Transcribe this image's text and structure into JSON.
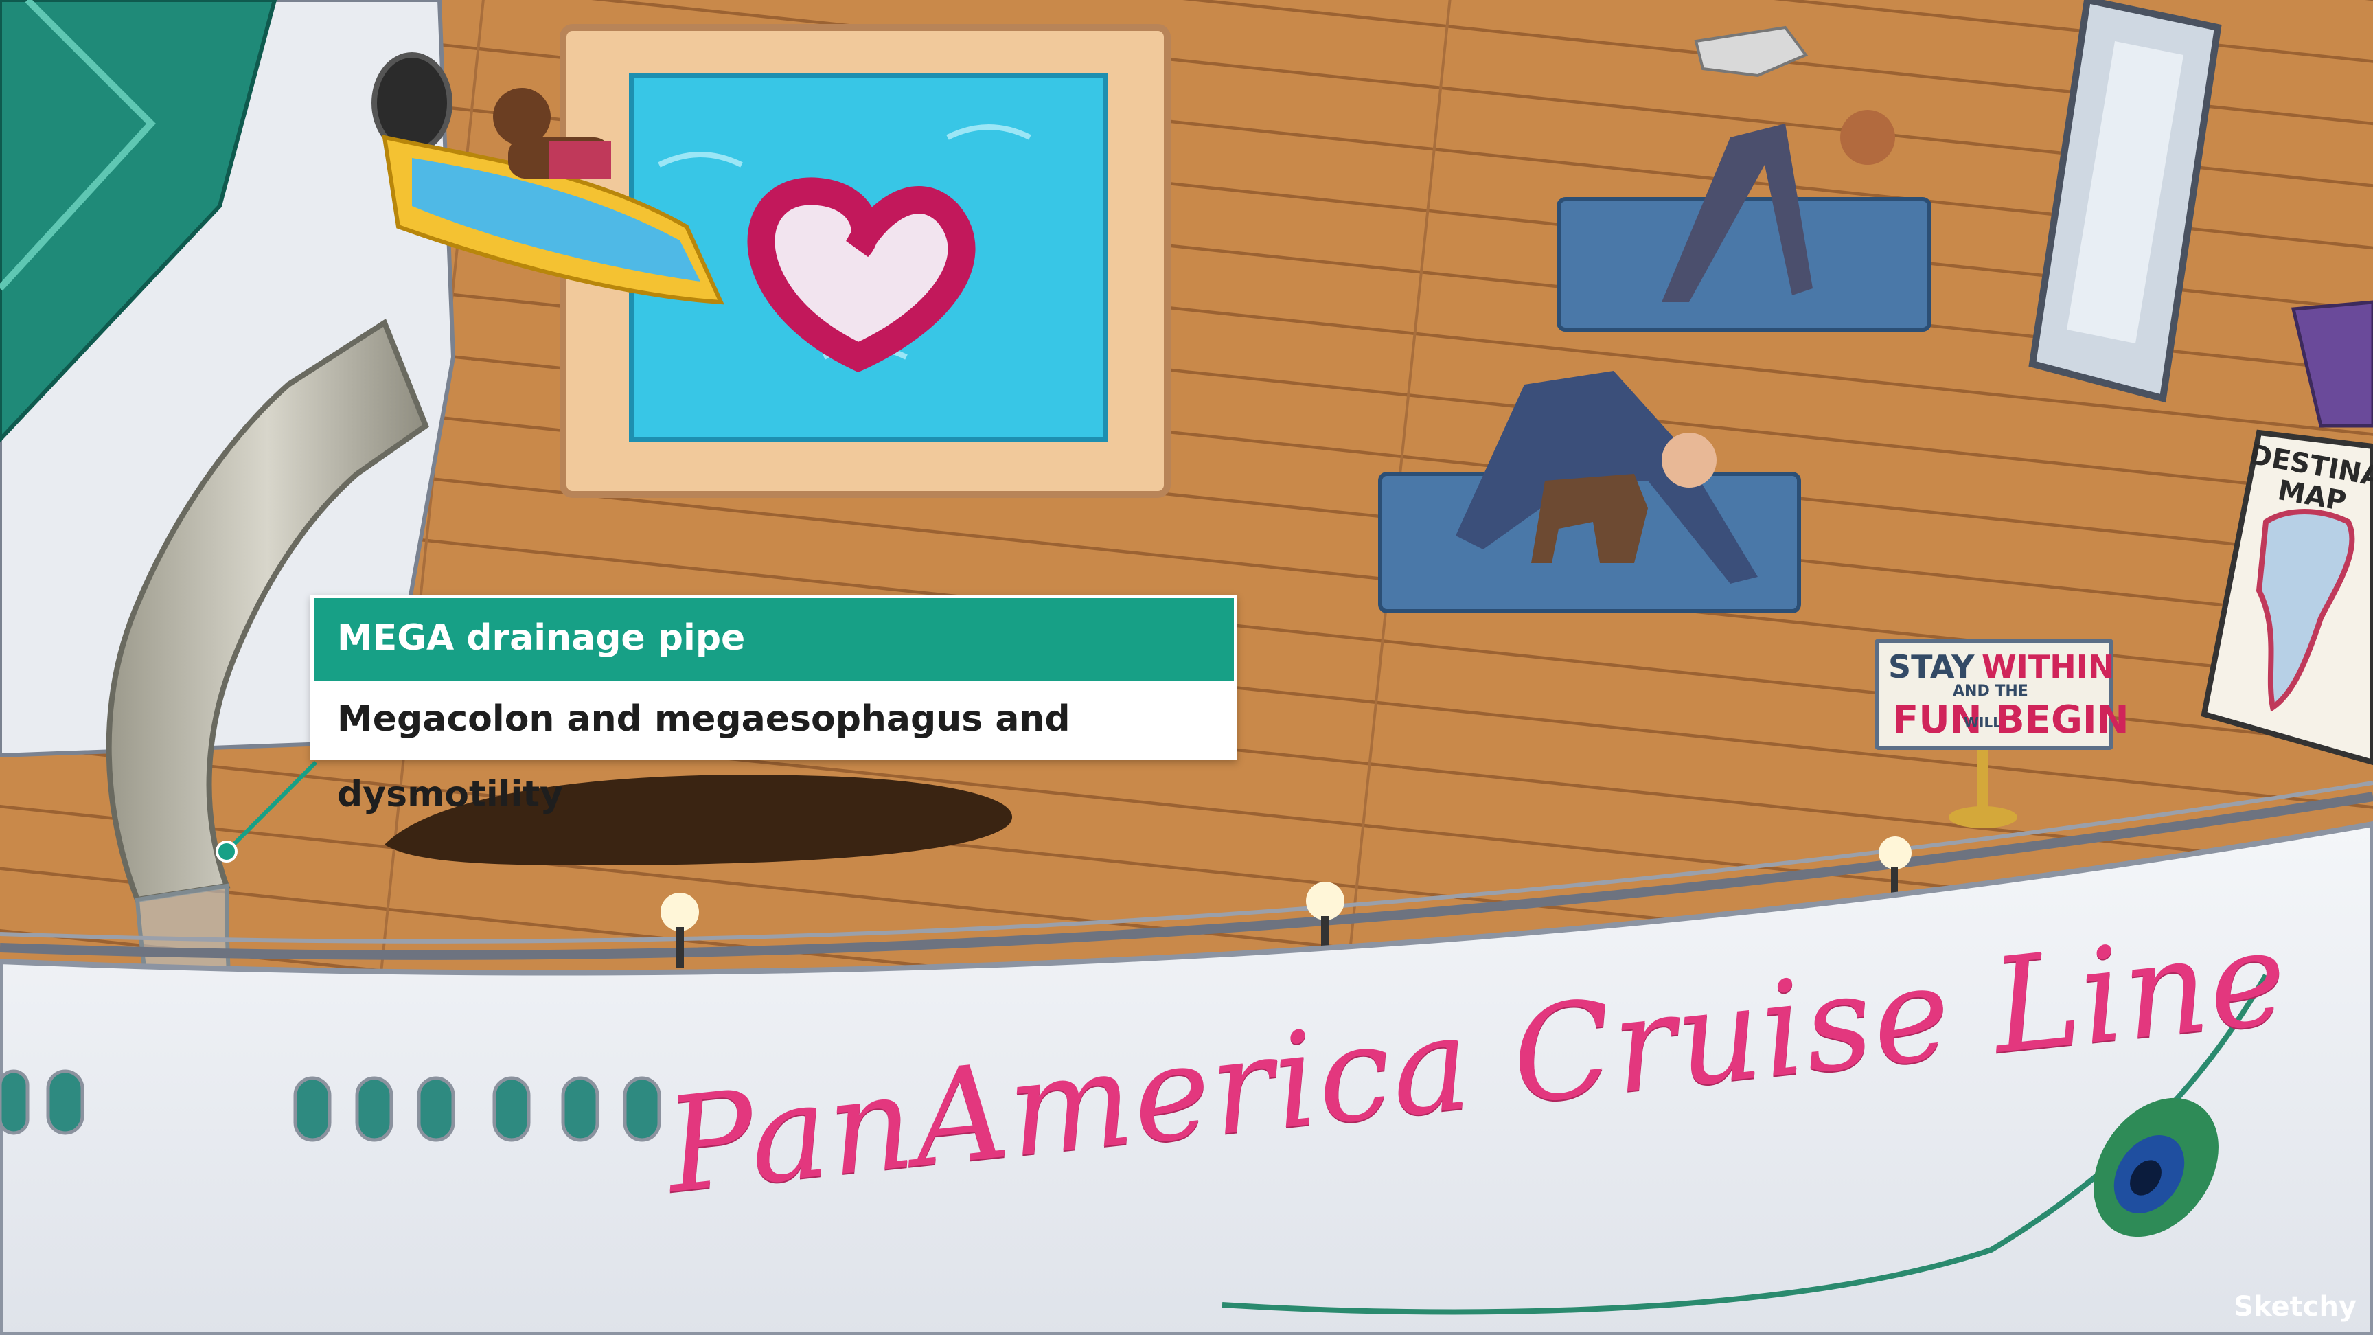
{
  "callout": {
    "title": "MEGA drainage pipe",
    "description": "Megacolon and megaesophagus and dysmotility"
  },
  "sign": {
    "line1a": "STAY",
    "line1b": "WITHIN",
    "line2": "AND THE",
    "line3a": "FUN",
    "line3b": "WILL",
    "line3c": "BEGIN"
  },
  "map": {
    "title_line1": "DESTINATION",
    "title_line2": "MAP"
  },
  "ship": {
    "name": "PanAmerica Cruise Line"
  },
  "brand": {
    "name": "Sketchy"
  },
  "colors": {
    "callout_header": "#17a086",
    "deck": "#c9894a",
    "hull": "#eef0f4",
    "pool_water": "#38c6e6",
    "ship_name": "#e3377e"
  }
}
